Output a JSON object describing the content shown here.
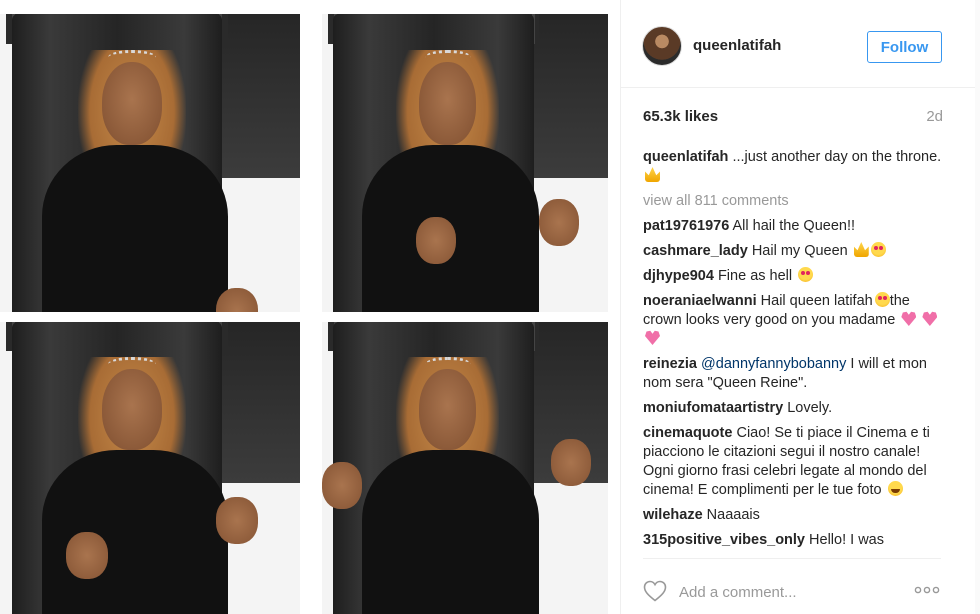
{
  "media": {
    "images": [
      "photo-1",
      "photo-2",
      "photo-3",
      "photo-4"
    ]
  },
  "header": {
    "username": "queenlatifah",
    "follow_label": "Follow"
  },
  "post": {
    "likes": "65.3k likes",
    "age": "2d"
  },
  "caption": {
    "user": "queenlatifah",
    "text": "...just another day on the throne."
  },
  "view_all": "view all 811 comments",
  "comments": [
    {
      "user": "pat19761976",
      "text": "All hail the Queen!!"
    },
    {
      "user": "cashmare_lady",
      "text": "Hail my Queen"
    },
    {
      "user": "djhype904",
      "text": "Fine as hell"
    },
    {
      "user": "noeraniaelwanni",
      "text": "Hail queen latifah",
      "text2": "the crown looks very good on you madame"
    },
    {
      "user": "reinezia",
      "mention": "@dannyfannybobanny",
      "text": "I will et mon nom sera \"Queen Reine\"."
    },
    {
      "user": "moniufomataartistry",
      "text": "Lovely."
    },
    {
      "user": "cinemaquote",
      "text": "Ciao! Se ti piace il Cinema e ti piacciono le citazioni segui il nostro canale! Ogni giorno frasi celebri legate al mondo del cinema! E complimenti per le tue foto"
    },
    {
      "user": "wilehaze",
      "text": "Naaaais"
    },
    {
      "user": "315positive_vibes_only",
      "text": "Hello! I was"
    }
  ],
  "add_comment": {
    "placeholder": "Add a comment..."
  },
  "icons": {
    "like": "heart-outline-icon",
    "more": "more-options-icon"
  },
  "colors": {
    "link_blue": "#3897f0",
    "text": "#262626",
    "muted": "#999999",
    "mention": "#003569"
  }
}
